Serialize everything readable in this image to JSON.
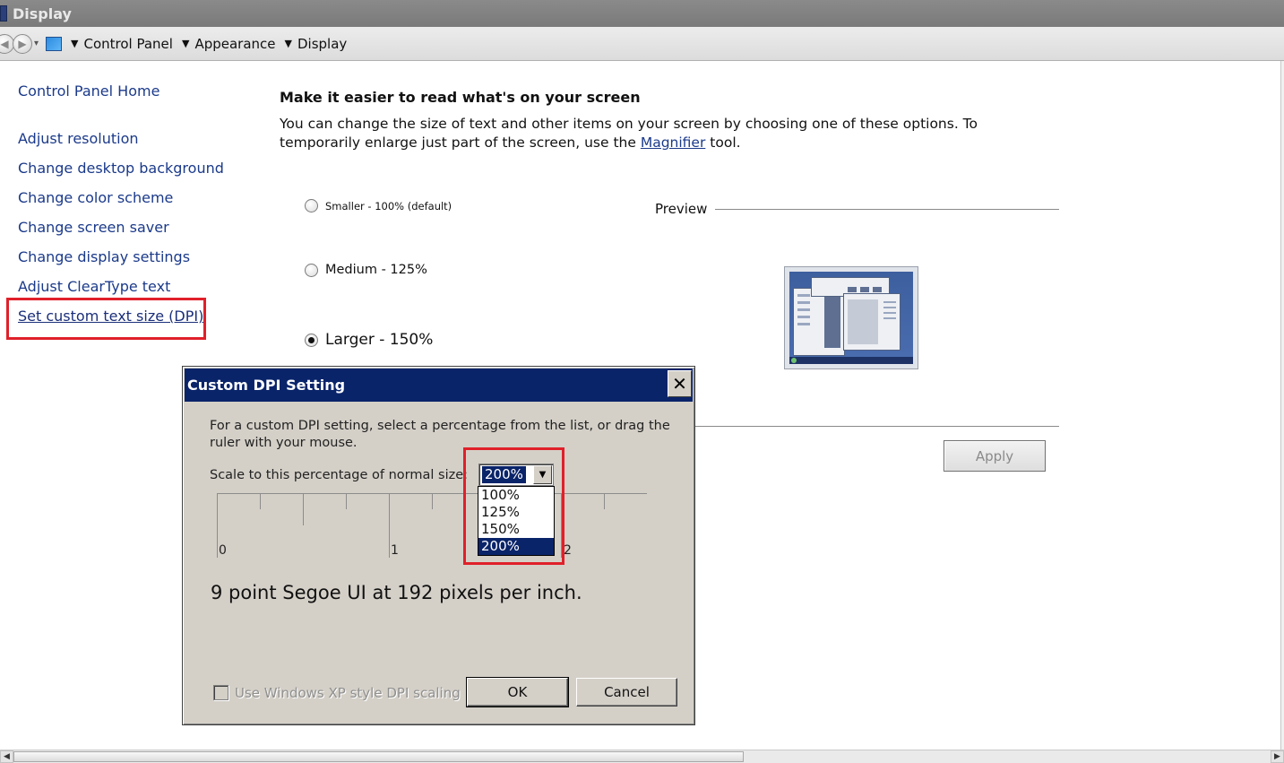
{
  "window": {
    "title": "Display"
  },
  "breadcrumb": [
    "Control Panel",
    "Appearance",
    "Display"
  ],
  "sidebar": {
    "home_link": "Control Panel Home",
    "links": [
      "Adjust resolution",
      "Change desktop background",
      "Change color scheme",
      "Change screen saver",
      "Change display settings",
      "Adjust ClearType text",
      "Set custom text size (DPI)"
    ]
  },
  "main": {
    "heading": "Make it easier to read what's on your screen",
    "description_before": "You can change the size of text and other items on your screen by choosing one of these options. To temporarily enlarge just part of the screen, use the ",
    "magnifier_link": "Magnifier",
    "description_after": " tool.",
    "options": [
      {
        "label": "Smaller - 100% (default)",
        "checked": false
      },
      {
        "label": "Medium - 125%",
        "checked": false
      },
      {
        "label": "Larger - 150%",
        "checked": true
      }
    ],
    "preview_label": "Preview",
    "apply_label": "Apply",
    "apply_enabled": false
  },
  "dialog": {
    "title": "Custom DPI Setting",
    "close_glyph": "✕",
    "instructions": "For a custom DPI setting, select a percentage from the list, or drag the ruler with your mouse.",
    "scale_label": "Scale to this percentage of normal size:",
    "scale_value": "200%",
    "scale_options": [
      "100%",
      "125%",
      "150%",
      "200%"
    ],
    "selected_option": "200%",
    "ruler_labels": [
      "0",
      "1",
      "2"
    ],
    "dpi_info": "9 point Segoe UI at 192 pixels per inch.",
    "xp_scaling_label": "Use Windows XP style DPI scaling",
    "xp_scaling_checked": false,
    "ok_label": "OK",
    "cancel_label": "Cancel"
  },
  "colors": {
    "dialog_title_bg": "#0a246a",
    "link": "#1b3a8a",
    "highlight": "#e0202a",
    "dialog_bg": "#d4d0c8"
  },
  "icons": {
    "back": "back-arrow-icon",
    "forward": "forward-arrow-icon",
    "control_panel": "control-panel-icon",
    "dropdown": "chevron-down-icon",
    "close": "close-icon"
  }
}
